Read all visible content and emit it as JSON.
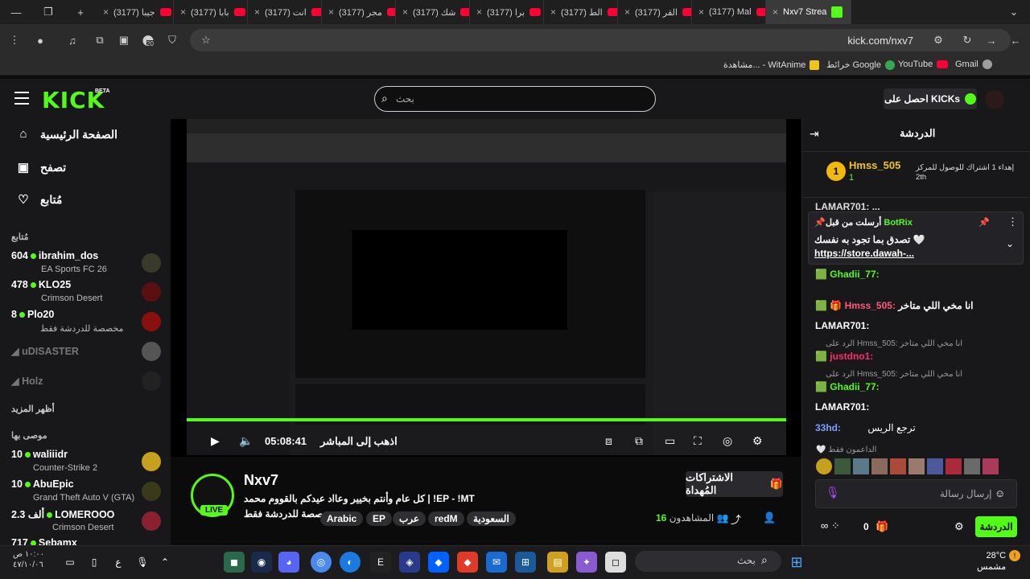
{
  "browser": {
    "tabs": [
      {
        "label": "Nxv7 Strea",
        "active": true
      },
      {
        "label": "(3177) Mal"
      },
      {
        "label": "(3177) القر"
      },
      {
        "label": "(3177) الط"
      },
      {
        "label": "(3177) برا"
      },
      {
        "label": "(3177) شك"
      },
      {
        "label": "(3177) مجر"
      },
      {
        "label": "(3177) انت"
      },
      {
        "label": "(3177) بابا"
      },
      {
        "label": "(3177) جيبا"
      }
    ],
    "url": "kick.com/nxv7",
    "bookmarks": [
      "Gmail",
      "YouTube",
      "خرائط Google",
      "مشاهدة... - WitAnime"
    ],
    "ext_badge": "20"
  },
  "header": {
    "logo": "KICK",
    "beta": "BETA",
    "search_placeholder": "بحث",
    "get_kicks": "احصل على KICKs"
  },
  "sidebar": {
    "nav": [
      "الصفحة الرئيسية",
      "تصفح",
      "مُتابع"
    ],
    "following_title": "مُتابع",
    "following": [
      {
        "count": "604",
        "name": "ibrahim_dos",
        "game": "EA Sports FC 26"
      },
      {
        "count": "478",
        "name": "KLO25",
        "game": "Crimson Desert"
      },
      {
        "count": "8",
        "name": "Plo20",
        "game": "مخصصة للدردشة فقط"
      },
      {
        "name": "uDISASTER"
      },
      {
        "name": "Holz"
      }
    ],
    "show_more": "أظهر المزيد",
    "recommended_title": "موصى بها",
    "recommended": [
      {
        "count": "10",
        "name": "waliiidr",
        "game": "Counter-Strike 2"
      },
      {
        "count": "10",
        "name": "AbuEpic",
        "game": "Grand Theft Auto V (GTA)"
      },
      {
        "count": "2.3 ألف",
        "name": "LOMEROOO",
        "game": "Crimson Desert"
      },
      {
        "count": "717",
        "name": "Sebamx"
      }
    ]
  },
  "player": {
    "time": "05:08:41",
    "go_live": "اذهب إلى المباشر"
  },
  "stream": {
    "channel": "Nxv7",
    "title_line1": "كل عام وأنتم بخيير وعااد عيدكم بالقووم محمد | !EP - !MT",
    "title_line2": "مخصصة للدردشة فقط",
    "tags": [
      "السعودية",
      "redM",
      "عرب",
      "EP",
      "Arabic"
    ],
    "live": "LIVE",
    "subs_button": "الاشتراكات المُهداة",
    "viewers_label": "المشاهدون",
    "viewers_count": "16"
  },
  "chat": {
    "title": "الدردشة",
    "top_gifter": {
      "name": "Hmss_505",
      "count": "1",
      "rank_text": "إهداء 1 اشتراك للوصول للمركز 2th"
    },
    "pinned_by": "BotRix",
    "pinned_label": "أرسلت من قبل",
    "pinned_text": "تصدق بما تجود به نفسك",
    "pinned_link": "https://store.dawah-...",
    "messages": [
      {
        "user": "LAMAR701:",
        "text": "..."
      },
      {
        "user": "Ghadii_77:",
        "text": ""
      },
      {
        "user": "Hmss_505:",
        "text": "انا مخي اللي متاخر"
      },
      {
        "user": "LAMAR701:",
        "text": ""
      },
      {
        "reply": "الرد على Hmss_505: انا مخي اللي متاخر",
        "user": "justdno1:",
        "text": ""
      },
      {
        "reply": "الرد على Hmss_505: انا مخي اللي متاخر",
        "user": "Ghadii_77:",
        "text": ""
      },
      {
        "user": "LAMAR701:",
        "text": ""
      },
      {
        "user": "33hd:",
        "text": "ترجع الريس"
      }
    ],
    "supporters_label": "الداعمون فقط",
    "input_placeholder": "إرسال رسالة",
    "send_button": "الدردشة",
    "points": "0"
  },
  "taskbar": {
    "weather_temp": "28°C",
    "weather_desc": "مشمس",
    "search": "بحث",
    "time": "١٠:٠٠ ص",
    "date": "٤٧/١٠/٠٦"
  }
}
